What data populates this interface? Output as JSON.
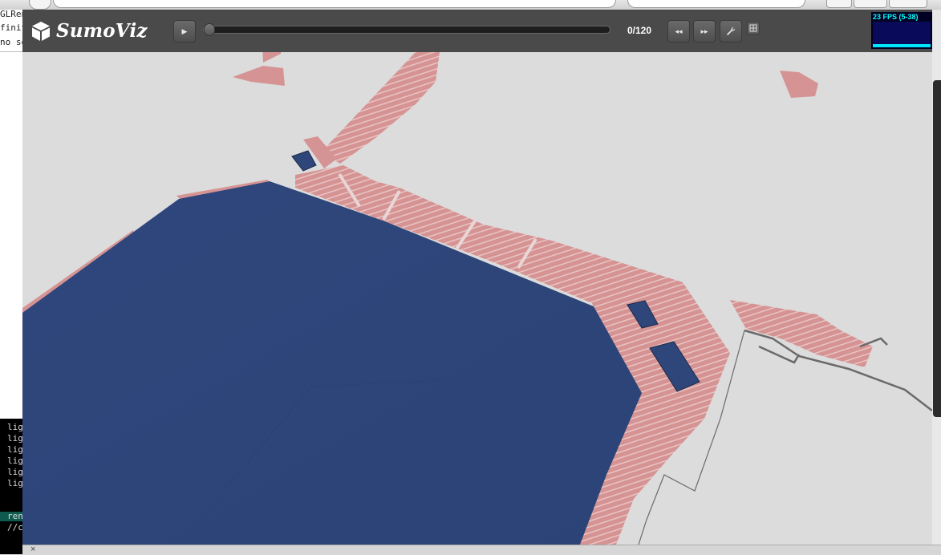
{
  "app": {
    "title": "SumoViz"
  },
  "toolbar": {
    "play_icon": "▶",
    "frame_counter": "0/120",
    "seek_position": 0,
    "rewind_icon": "◂◂",
    "forward_icon": "▸▸",
    "settings_icon": "wrench-icon",
    "grid_icon": "grid-icon"
  },
  "stats": {
    "fps_text": "23 FPS (5-38)"
  },
  "editor": {
    "lines": [
      "GLRen",
      "finit",
      "no so"
    ]
  },
  "terminal": {
    "lines": [
      "lig",
      "lig",
      "lig",
      "lig",
      "lig",
      "lig"
    ],
    "highlight_line": "ren",
    "comment_line": "//c"
  },
  "status": {
    "close_icon": "×"
  },
  "colors": {
    "toolbar_bg": "#4a4a4a",
    "obstacle": "#2e4679",
    "walkway": "#d48f8f",
    "ground": "#dcdcdc",
    "fps_text": "#00ffff"
  }
}
